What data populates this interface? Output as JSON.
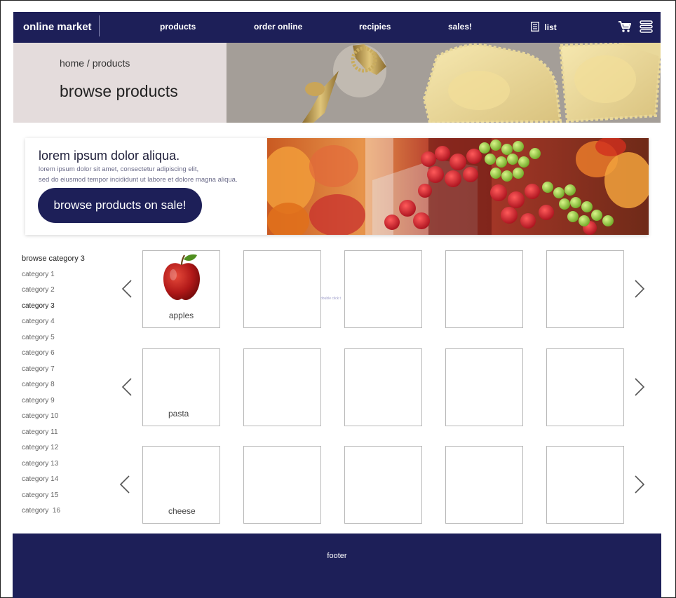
{
  "nav": {
    "brand": "online market",
    "links": [
      "products",
      "order online",
      "recipies",
      "sales!"
    ],
    "list_label": "list",
    "icons": [
      "list-icon",
      "cart-icon",
      "menu-icon"
    ]
  },
  "hero": {
    "breadcrumb_home": "home",
    "breadcrumb_sep": " / ",
    "breadcrumb_current": "products",
    "title": "browse products",
    "image": "ravioli-photo"
  },
  "promo": {
    "title": "lorem ipsum dolor aliqua.",
    "body_line1": "lorem ipsum dolor sit amet, consectetur adipiscing elit,",
    "body_line2": "sed do eiusmod tempor incididunt ut labore et dolore magna aliqua.",
    "button": "browse products on sale!",
    "image": "fruit-market-photo"
  },
  "sidebar": {
    "heading": "browse category 3",
    "categories": [
      "category 1",
      "category 2",
      "category 3",
      "category 4",
      "category 5",
      "category 6",
      "category 7",
      "category 8",
      "category 9",
      "category 10",
      "category 11",
      "category 12",
      "category 13",
      "category 14",
      "category 15",
      "category  16"
    ],
    "active": "category 3"
  },
  "grid": {
    "rows": [
      {
        "label": "apples",
        "image": "apple-icon"
      },
      {
        "label": "pasta"
      },
      {
        "label": "cheese"
      }
    ],
    "tiles_per_row": 5,
    "hint": "double click t"
  },
  "footer": {
    "text": "footer"
  },
  "colors": {
    "primary": "#1d1f58",
    "hero_bg": "#e4dcdc"
  }
}
